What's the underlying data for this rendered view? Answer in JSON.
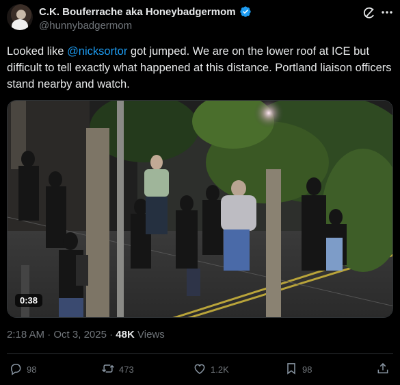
{
  "author": {
    "display_name": "C.K. Bouferrache aka Honeybadgermom",
    "handle": "@hunnybadgermom",
    "verified": true
  },
  "tweet": {
    "text_before": "Looked like ",
    "mention": "@nicksortor",
    "text_after": " got jumped. We are on the lower roof at ICE  but difficult to tell exactly what happened at this distance. Portland liaison officers stand nearby and watch."
  },
  "media": {
    "type": "video",
    "duration": "0:38"
  },
  "meta": {
    "time": "2:18 AM",
    "separator": "·",
    "date": "Oct 3, 2025",
    "views_count": "48K",
    "views_label": "Views"
  },
  "actions": {
    "replies": "98",
    "reposts": "473",
    "likes": "1.2K",
    "bookmarks": "98"
  },
  "colors": {
    "accent": "#1d9bf0",
    "background": "#000000",
    "muted": "#71767b"
  },
  "icons": [
    "verified-badge-icon",
    "grok-icon",
    "more-icon",
    "reply-icon",
    "repost-icon",
    "like-icon",
    "bookmark-icon",
    "share-icon"
  ]
}
